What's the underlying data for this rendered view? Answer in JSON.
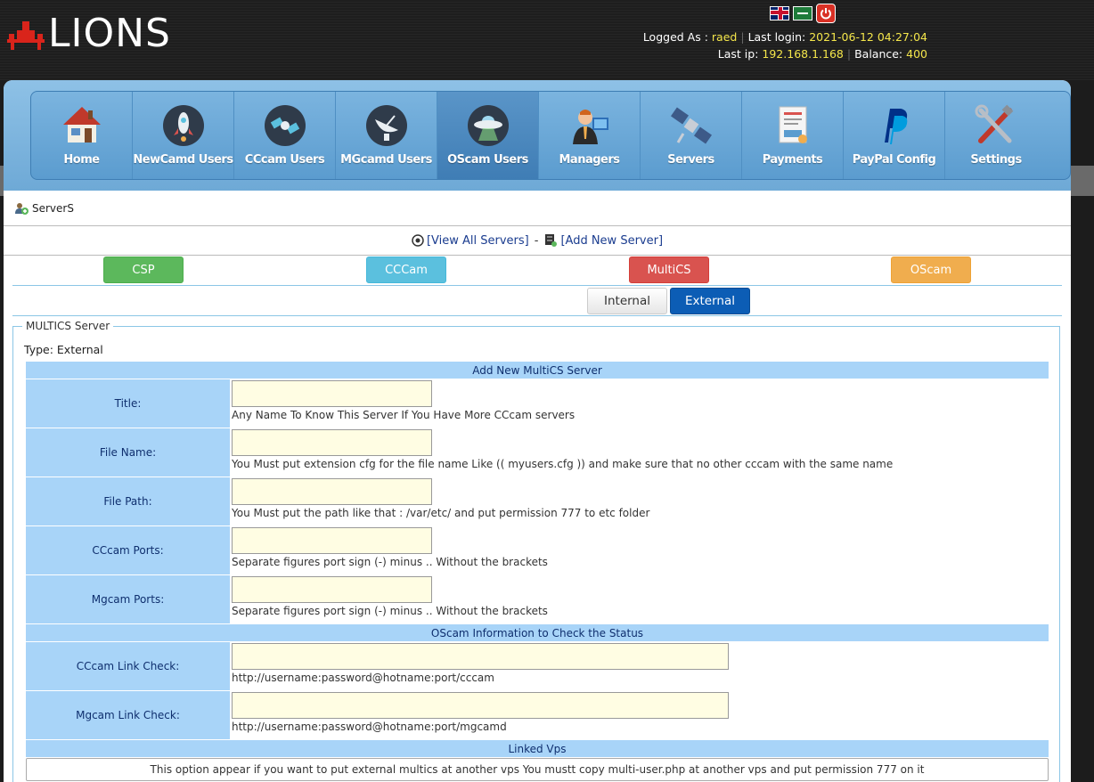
{
  "header": {
    "logo_text": "LIONS",
    "logged_as_label": "Logged As :",
    "username": "raed",
    "last_login_label": "Last login:",
    "last_login": "2021-06-12 04:27:04",
    "last_ip_label": "Last ip:",
    "last_ip": "192.168.1.168",
    "balance_label": "Balance:",
    "balance": "400"
  },
  "nav": {
    "items": [
      {
        "label": "Home",
        "icon": "house-icon"
      },
      {
        "label": "NewCamd Users",
        "icon": "rocket-icon"
      },
      {
        "label": "CCcam Users",
        "icon": "satellite-icon"
      },
      {
        "label": "MGcamd Users",
        "icon": "dish-icon"
      },
      {
        "label": "OScam Users",
        "icon": "ufo-icon"
      },
      {
        "label": "Managers",
        "icon": "manager-icon"
      },
      {
        "label": "Servers",
        "icon": "satellite-icon"
      },
      {
        "label": "Payments",
        "icon": "invoice-icon"
      },
      {
        "label": "PayPal Config",
        "icon": "paypal-icon"
      },
      {
        "label": "Settings",
        "icon": "tools-icon"
      }
    ],
    "active_index": 4
  },
  "breadcrumb": {
    "label": "ServerS"
  },
  "actions": {
    "view_all": "[View All Servers]",
    "separator": "-",
    "add_new": "[Add New Server]"
  },
  "types": {
    "csp": "CSP",
    "cccam": "CCCam",
    "multics": "MultiCS",
    "oscam": "OScam"
  },
  "modes": {
    "internal": "Internal",
    "external": "External"
  },
  "form": {
    "legend": "MULTICS Server",
    "type_label": "Type: External",
    "section_main": "Add New MultiCS Server",
    "rows": [
      {
        "label": "Title:",
        "value": "",
        "hint": "Any Name To Know This Server If You Have More CCcam servers"
      },
      {
        "label": "File Name:",
        "value": "",
        "hint": "You Must put extension cfg for the file name Like (( myusers.cfg )) and make sure that no other cccam with the same name"
      },
      {
        "label": "File Path:",
        "value": "",
        "hint": "You Must put the path like that : /var/etc/ and put permission 777 to etc folder"
      },
      {
        "label": "CCcam Ports:",
        "value": "",
        "hint": "Separate figures port sign (-) minus .. Without the brackets"
      },
      {
        "label": "Mgcam Ports:",
        "value": "",
        "hint": "Separate figures port sign (-) minus .. Without the brackets"
      }
    ],
    "section_oscam": "OScam Information to Check the Status",
    "oscam_rows": [
      {
        "label": "CCcam Link Check:",
        "value": "",
        "hint": "http://username:password@hotname:port/cccam"
      },
      {
        "label": "Mgcam Link Check:",
        "value": "",
        "hint": "http://username:password@hotname:port/mgcamd"
      }
    ],
    "section_linked": "Linked Vps",
    "linked_note": "This option appear if you want to put external multics at another vps You mustt copy multi-user.php at another vps and put permission 777 on it"
  },
  "colors": {
    "accent_blue": "#0c5db5",
    "label_bg": "#a8d4f8",
    "csp": "#5cb85c",
    "cccam": "#5bc0de",
    "multics": "#d9534f",
    "oscam": "#f0ad4e",
    "highlight_text": "#f4e64b"
  }
}
